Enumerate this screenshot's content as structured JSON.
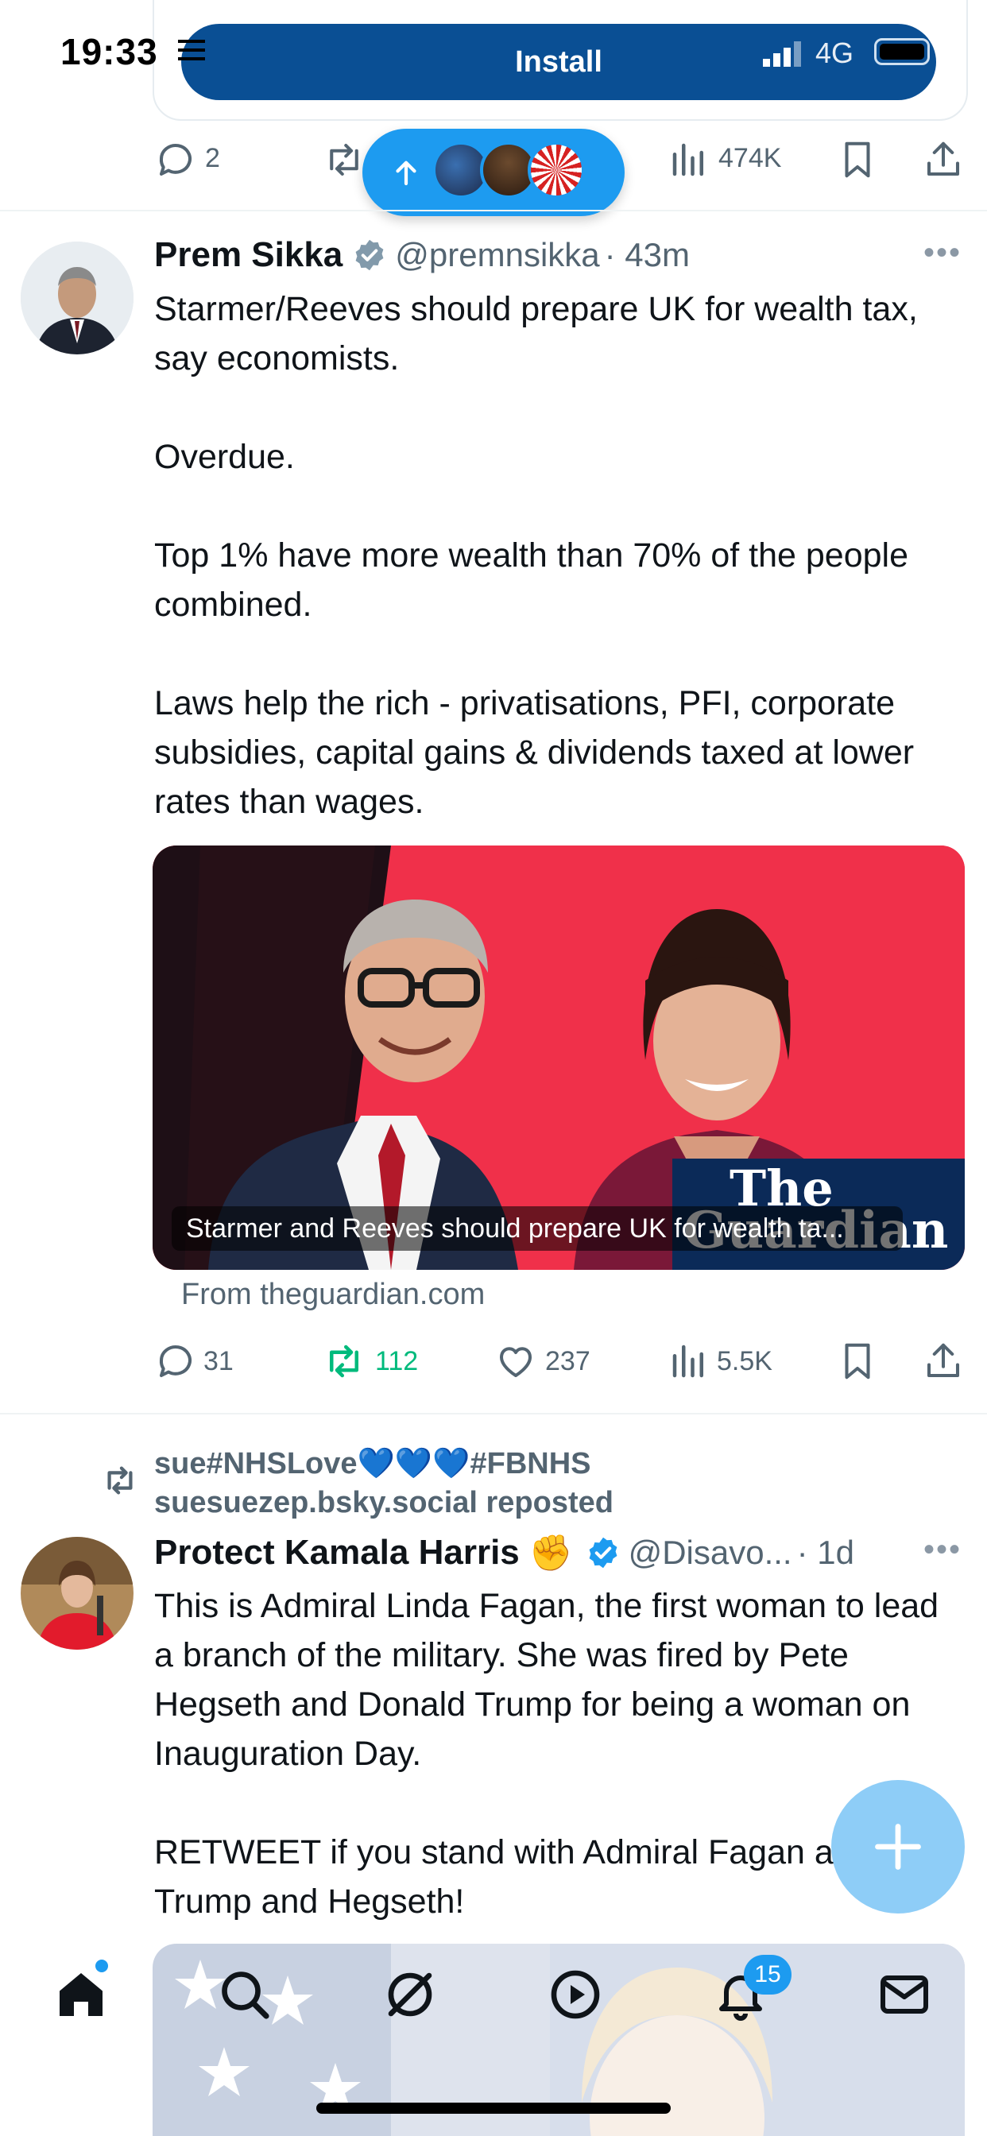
{
  "status_bar": {
    "time": "19:33",
    "network": "4G"
  },
  "install_banner": {
    "label": "Install"
  },
  "prev_tweet_actions": {
    "reply_count": "2",
    "views": "474K"
  },
  "tweet1": {
    "name": "Prem Sikka",
    "handle": "@premnsikka",
    "time": "· 43m",
    "text": "Starmer/Reeves should prepare UK for wealth tax, say economists.\n\nOverdue.\n\nTop 1% have more wealth than 70% of the people combined.\n\nLaws help the rich - privatisations, PFI, corporate subsidies, capital gains & dividends taxed at lower rates than wages.",
    "card_caption": "Starmer and Reeves should prepare UK for wealth ta...",
    "card_logo_line1": "The",
    "card_logo_line2": "Guardian",
    "card_source": "From theguardian.com",
    "replies": "31",
    "reposts": "112",
    "likes": "237",
    "views": "5.5K"
  },
  "tweet2": {
    "repost_by_line1": "sue#NHSLove💙💙💙#FBNHS",
    "repost_by_line2": "suesuezep.bsky.social reposted",
    "name": "Protect Kamala Harris",
    "name_emoji": "✊",
    "handle": "@Disavo...",
    "time": "· 1d",
    "text": "This is Admiral Linda Fagan, the first woman to lead a branch of the military. She was fired by Pete Hegseth and Donald Trump for being a woman on Inauguration Day.\n\nRETWEET if you stand with Admiral Fagan against Trump and Hegseth!"
  },
  "tabbar": {
    "notifications_badge": "15"
  },
  "colors": {
    "accent": "#1d9bf0",
    "repost_green": "#00ba7c",
    "install_bg": "#0a4f94",
    "secondary_text": "#536471"
  }
}
